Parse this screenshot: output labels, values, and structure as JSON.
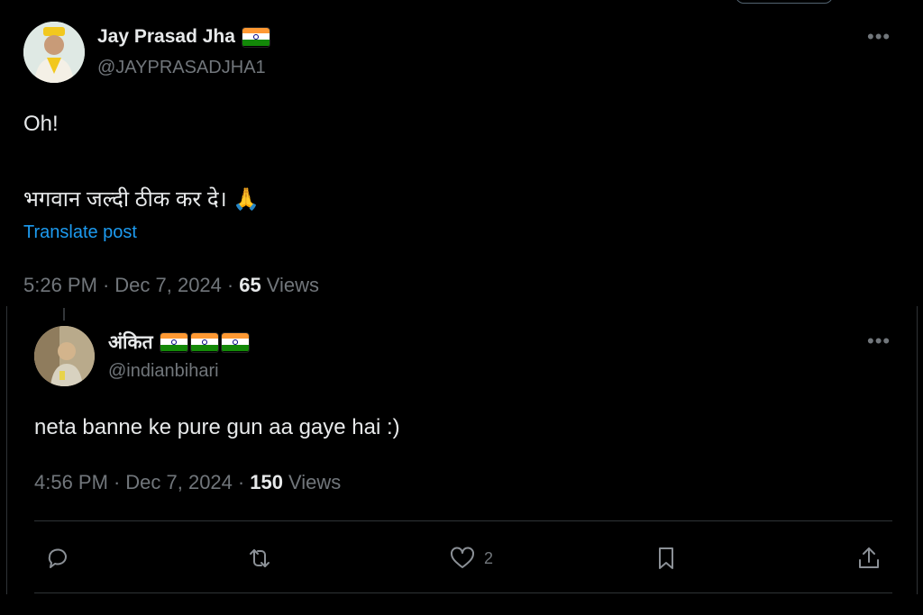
{
  "tweet": {
    "author_name": "Jay Prasad Jha",
    "handle": "@JAYPRASADJHA1",
    "more_icon": "more-horizontal-icon",
    "line1": "Oh!",
    "line2": "भगवान जल्दी ठीक कर दे। 🙏",
    "translate": "Translate post",
    "time": "5:26 PM",
    "date": "Dec 7, 2024",
    "views_count": "65",
    "views_label": "Views"
  },
  "quoted": {
    "author_name": "अंकित",
    "handle": "@indianbihari",
    "text": "neta banne ke pure gun aa gaye hai :)",
    "time": "4:56 PM",
    "date": "Dec 7, 2024",
    "views_count": "150",
    "views_label": "Views"
  },
  "actions": {
    "reply_icon": "reply-icon",
    "retweet_icon": "retweet-icon",
    "like_icon": "heart-icon",
    "like_count": "2",
    "bookmark_icon": "bookmark-icon",
    "share_icon": "share-icon"
  },
  "separator": "·",
  "colors": {
    "background": "#000000",
    "text": "#e7e9ea",
    "muted": "#71767b",
    "link": "#1d9bf0",
    "border": "#2f3336"
  }
}
